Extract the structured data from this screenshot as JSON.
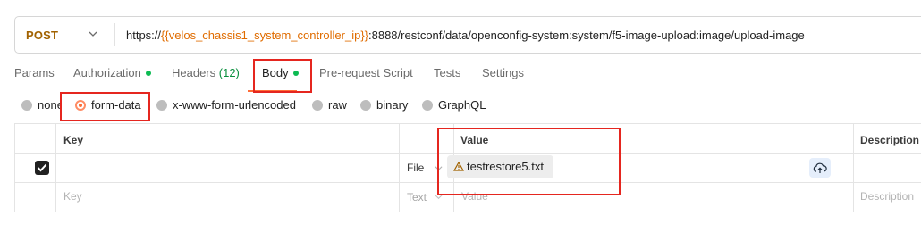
{
  "request": {
    "method": "POST",
    "url_prefix": "https://",
    "url_variable": "{{velos_chassis1_system_controller_ip}}",
    "url_suffix": ":8888/restconf/data/openconfig-system:system/f5-image-upload:image/upload-image"
  },
  "tabs": [
    {
      "label": "Params"
    },
    {
      "label": "Authorization"
    },
    {
      "label": "Headers",
      "count": "(12)"
    },
    {
      "label": "Body"
    },
    {
      "label": "Pre-request Script"
    },
    {
      "label": "Tests"
    },
    {
      "label": "Settings"
    }
  ],
  "body_modes": [
    {
      "label": "none"
    },
    {
      "label": "form-data",
      "selected": true
    },
    {
      "label": "x-www-form-urlencoded"
    },
    {
      "label": "raw"
    },
    {
      "label": "binary"
    },
    {
      "label": "GraphQL"
    }
  ],
  "table": {
    "headers": {
      "key": "Key",
      "value": "Value",
      "description": "Description"
    },
    "rows": [
      {
        "checked": true,
        "key": "",
        "type": "File",
        "value_file": "testrestore5.txt",
        "description": ""
      }
    ],
    "new_row": {
      "key_placeholder": "Key",
      "type": "Text",
      "value_placeholder": "Value",
      "description_placeholder": "Description"
    }
  },
  "colors": {
    "accent": "#ff6c37",
    "highlight": "#e5261f",
    "method": "#a16200",
    "variable": "#e06c00",
    "active_dot": "#0cbb52"
  },
  "icons": [
    "chevron-down-icon",
    "checkmark-icon",
    "warning-icon",
    "cloud-upload-icon"
  ]
}
